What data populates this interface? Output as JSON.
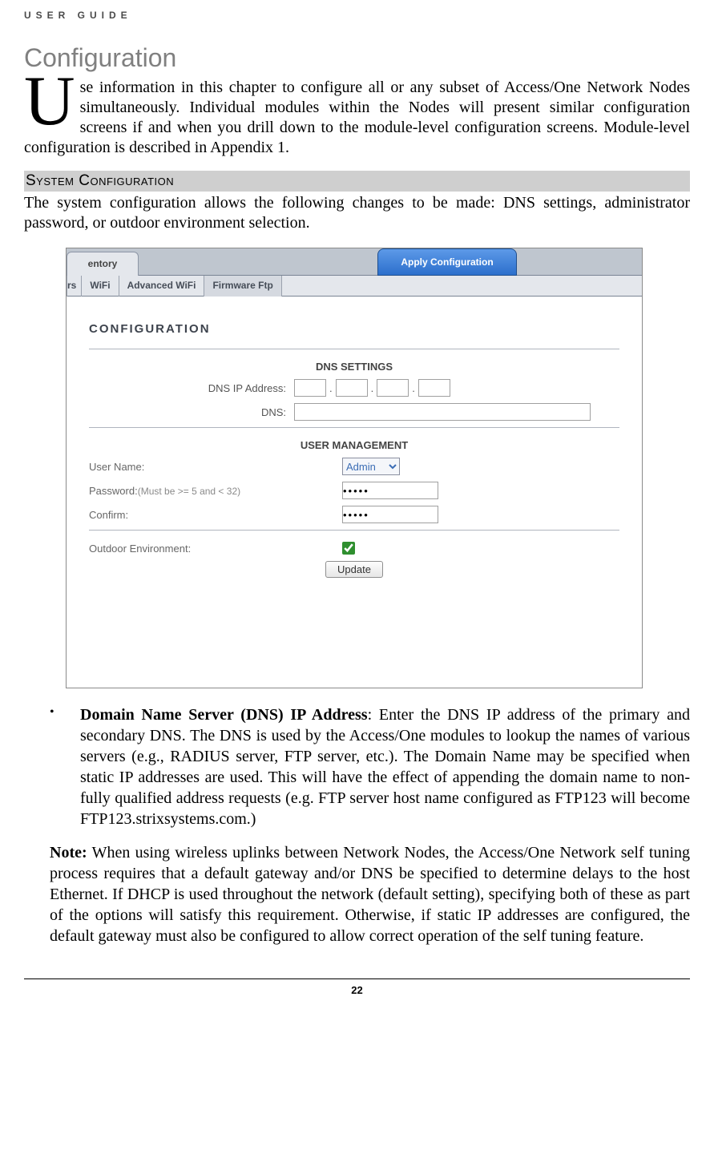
{
  "header": "USER GUIDE",
  "chapter_title": "Configuration",
  "intro": {
    "dropcap": "U",
    "text": "se information in this chapter to configure all or any subset of Access/One Network Nodes simultaneously. Individual modules within the Nodes will present similar configuration screens if and when you drill down to the module-level configuration screens. Module-level configuration is described in Appendix 1."
  },
  "system_cfg": {
    "heading": "System Configuration",
    "desc": "The system configuration allows the following changes to be made: DNS settings, administrator password, or outdoor environment selection."
  },
  "screenshot": {
    "tab_inventory": "entory",
    "tab_apply": "Apply Configuration",
    "tabs2": {
      "rs": "rs",
      "wifi": "WiFi",
      "advwifi": "Advanced WiFi",
      "fwftp": "Firmware Ftp"
    },
    "cfg_title": "CONFIGURATION",
    "dns_heading": "DNS SETTINGS",
    "dns_ip_label": "DNS IP Address:",
    "dns_label": "DNS:",
    "user_mgmt_heading": "USER MANAGEMENT",
    "user_name_label": "User Name:",
    "user_name_value": "Admin",
    "password_label": "Password:",
    "password_hint": "(Must be >= 5 and < 32)",
    "password_value": "•••••",
    "confirm_label": "Confirm:",
    "confirm_value": "•••••",
    "outdoor_label": "Outdoor Environment:",
    "update_btn": "Update"
  },
  "bullet": {
    "title": "Domain Name Server (DNS) IP Address",
    "text": ": Enter the DNS IP address of the primary and secondary DNS. The DNS is used by the Access/One modules to lookup the names of various servers (e.g., RADIUS server, FTP server, etc.). The Domain Name may be specified when static IP addresses are used. This will have the effect of appending the domain name to non-fully qualified address requests (e.g. FTP server host name configured as FTP123 will become FTP123.strixsystems.com.)"
  },
  "note": {
    "lead": "Note:",
    "text": " When using wireless uplinks between Network Nodes, the Access/One Network self tuning process requires that a default gateway and/or DNS be specified to determine delays to the host Ethernet. If DHCP is used throughout the network (default setting), specifying both of these as part of the options will satisfy this requirement. Otherwise, if static IP addresses are configured, the default gateway must also be configured to allow correct operation of the self tuning feature."
  },
  "page_number": "22"
}
